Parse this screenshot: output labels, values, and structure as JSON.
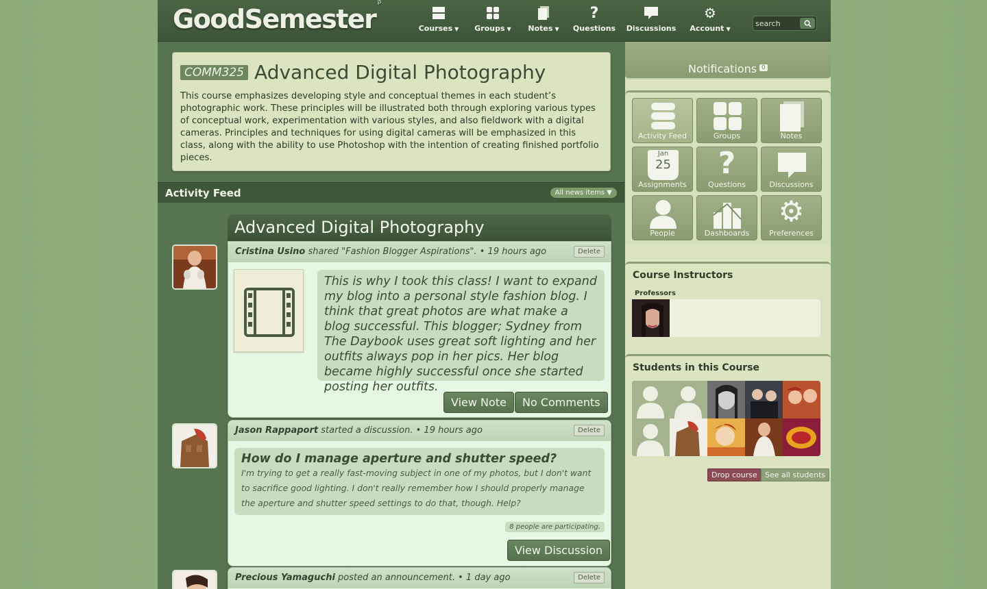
{
  "header": {
    "logo": "GoodSemester",
    "beta": "β",
    "nav": [
      {
        "label": "Courses",
        "caret": true
      },
      {
        "label": "Groups",
        "caret": true
      },
      {
        "label": "Notes",
        "caret": true
      },
      {
        "label": "Questions",
        "caret": false
      },
      {
        "label": "Discussions",
        "caret": false
      },
      {
        "label": "Account",
        "caret": true
      }
    ],
    "search_placeholder": "search"
  },
  "course": {
    "code": "COMM325",
    "title": "Advanced Digital Photography",
    "description": "This course emphasizes developing style and conceptual themes in each student’s photographic work. These principles will be illustrated both through exploring various types of conceptual work, experimentation with various styles, and also fieldwork with a digital cameras. Principles and techniques for using digital cameras will be emphasized in this class, along with the ability to use Photoshop with the intention of creating finished portfolio pieces."
  },
  "activity": {
    "title": "Activity Feed",
    "filter": "All news items",
    "feed_title": "Advanced Digital Photography",
    "items": [
      {
        "author": "Cristina Usino",
        "action": " shared \"Fashion Blogger Aspirations\". • 19 hours ago",
        "delete": "Delete",
        "quote": "This is why I took this class! I want to expand my blog into a personal style fashion blog. I think that great photos are what make a blog successful. This blogger; Sydney from The Daybook uses great soft lighting and her outfits always pop in her pics. Her blog became highly successful once she started posting her outfits.",
        "btn_view": "View Note",
        "btn_comments": "No Comments"
      },
      {
        "author": "Jason Rappaport",
        "action": " started a discussion. • 19 hours ago",
        "delete": "Delete",
        "question": "How do I manage aperture and shutter speed?",
        "body": "I'm trying to get a really fast-moving subject in one of my photos, but I don't want to sacrifice good lighting. I don't really remember how I should properly manage the aperture and shutter speed settings to do that, though. Help?",
        "participants": "8 people are participating.",
        "btn_view": "View Discussion"
      },
      {
        "author": "Precious Yamaguchi",
        "action": " posted an announcement. • 1 day ago",
        "delete": "Delete"
      }
    ]
  },
  "sidebar": {
    "notifications_label": "Notifications",
    "notifications_count": "0",
    "tiles": [
      "Activity Feed",
      "Groups",
      "Notes",
      "Assignments",
      "Questions",
      "Discussions",
      "People",
      "Dashboards",
      "Preferences"
    ],
    "calendar": {
      "month": "Jan",
      "day": "25"
    },
    "instructors_title": "Course Instructors",
    "professors_label": "Professors",
    "students_title": "Students in this Course",
    "drop_course": "Drop course",
    "see_all": "See all students"
  },
  "colors": {
    "accent": "#577450",
    "header": "#3d5438",
    "panel": "#dbe3c0",
    "drop": "#8a4b55"
  }
}
